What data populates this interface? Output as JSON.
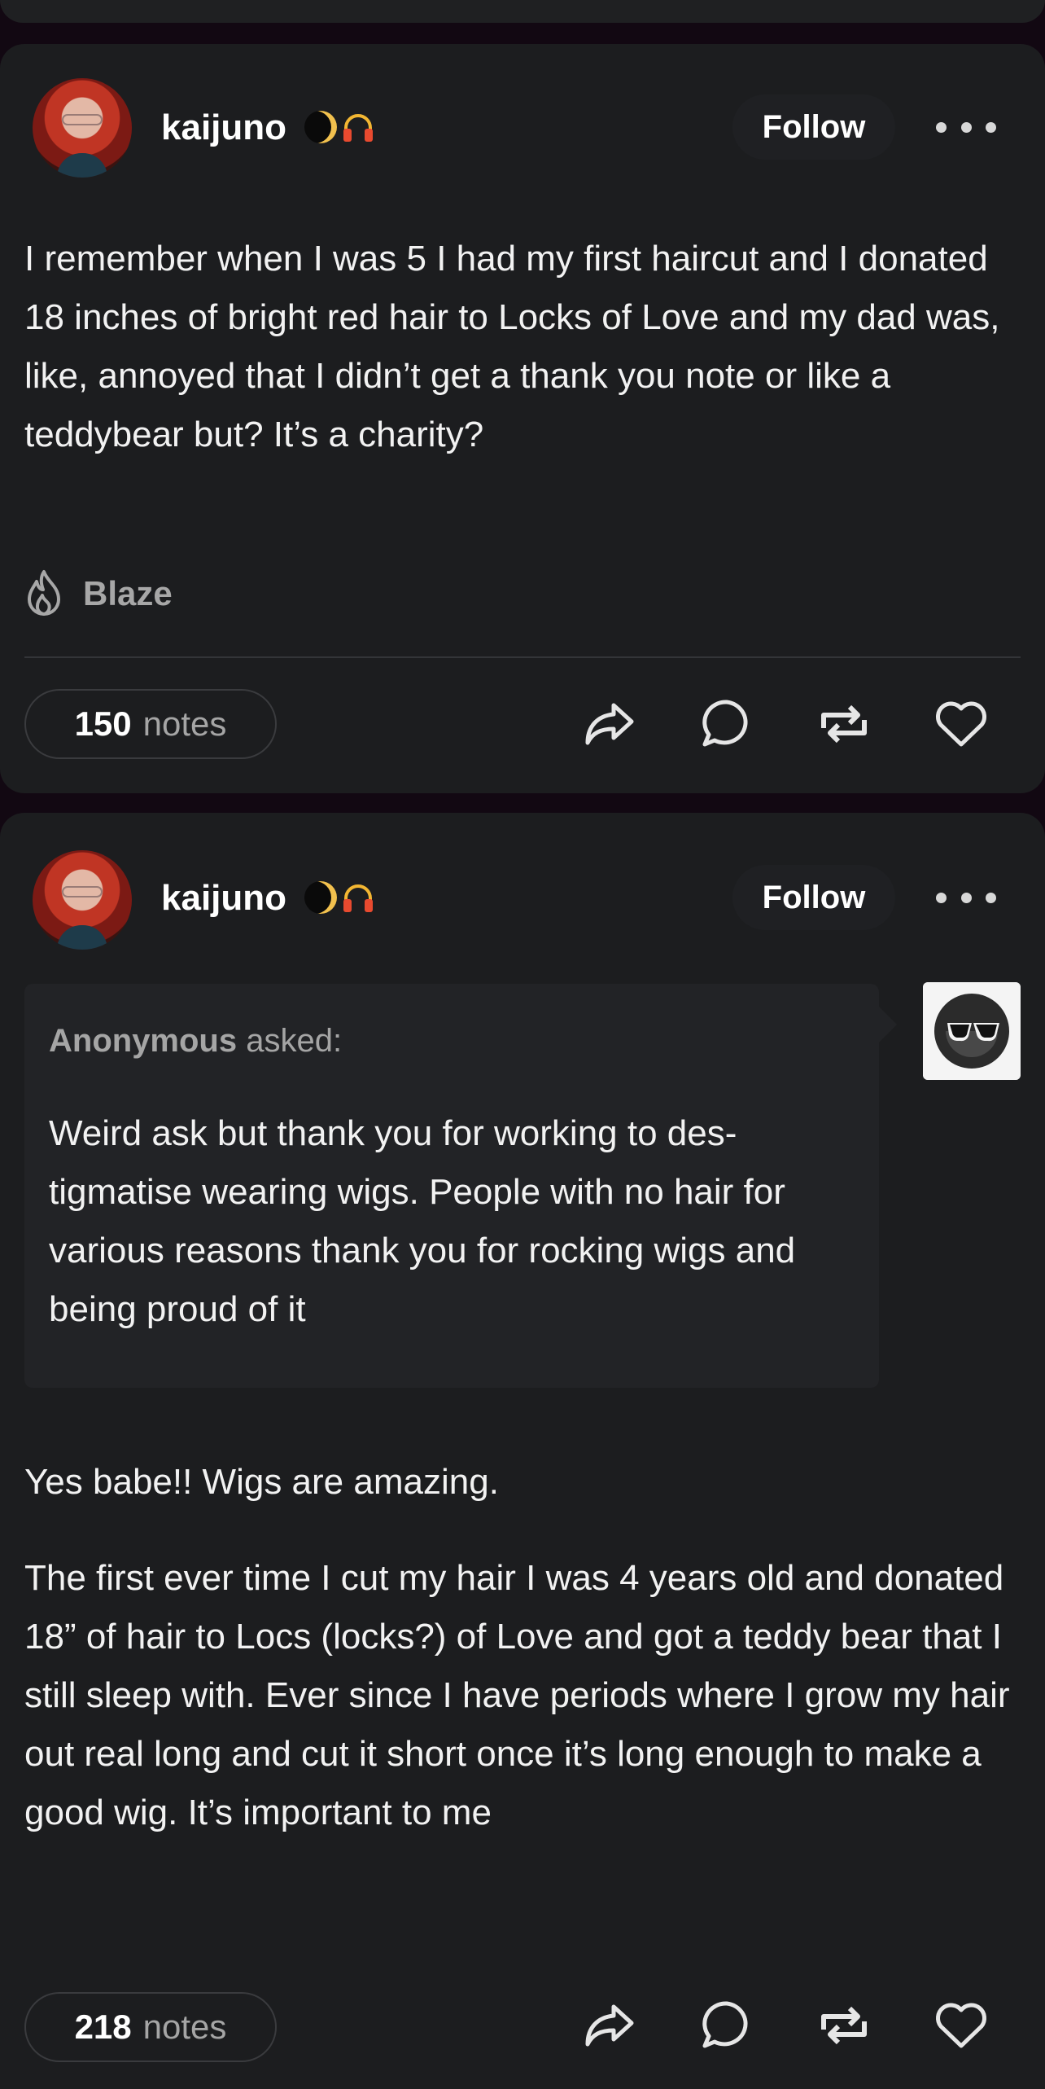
{
  "colors": {
    "background": "#120812",
    "card": "#1c1d1f",
    "ask_box": "#222326",
    "muted_text": "#a5a5a5"
  },
  "posts": [
    {
      "username": "kaijuno",
      "badges": [
        "moon-icon",
        "headphones-icon"
      ],
      "follow_label": "Follow",
      "body": "I remember when I was 5 I had my first haircut and I donated 18 inches of bright red hair to Locks of Love and my dad was, like, annoyed that I didn’t get a thank you note or like a teddybear but? It’s a charity?",
      "blaze_label": "Blaze",
      "notes_count": "150",
      "notes_label": "notes"
    },
    {
      "username": "kaijuno",
      "badges": [
        "moon-icon",
        "headphones-icon"
      ],
      "follow_label": "Follow",
      "ask": {
        "asker": "Anonymous",
        "asked_label": "asked:",
        "question": "Weird ask but thank you for working to des-tigmatise wearing wigs. People with no hair for various reasons thank you for rocking wigs and being proud of it"
      },
      "answer": [
        "Yes babe!! Wigs are amazing.",
        "The first ever time I cut my hair I was 4 years old and donated 18” of hair to Locs (locks?) of Love and got a teddy bear that I still sleep with. Ever since I have periods where I grow my hair out real long and cut it short once it’s long enough to make a good wig. It’s important to me"
      ],
      "notes_count": "218",
      "notes_label": "notes"
    }
  ]
}
